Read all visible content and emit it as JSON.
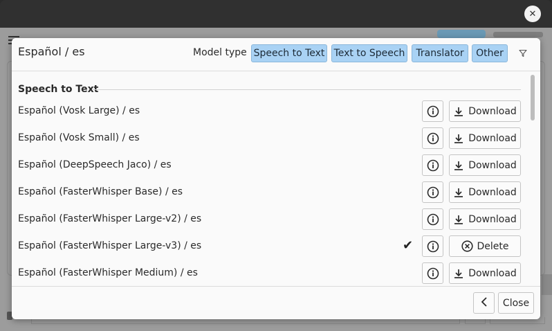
{
  "dialog": {
    "title": "Español / es",
    "model_type_label": "Model type",
    "chips": [
      "Speech to Text",
      "Text to Speech",
      "Translator",
      "Other"
    ],
    "filter_icon": "filter-icon",
    "section": "Speech to Text",
    "rows": [
      {
        "name": "Español (Vosk Large) / es",
        "action": "Download",
        "installed": false
      },
      {
        "name": "Español (Vosk Small) / es",
        "action": "Download",
        "installed": false
      },
      {
        "name": "Español (DeepSpeech Jaco) / es",
        "action": "Download",
        "installed": false
      },
      {
        "name": "Español (FasterWhisper Base) / es",
        "action": "Download",
        "installed": false
      },
      {
        "name": "Español (FasterWhisper Large-v2) / es",
        "action": "Download",
        "installed": false
      },
      {
        "name": "Español (FasterWhisper Large-v3) / es",
        "action": "Delete",
        "installed": true,
        "check": "✔"
      },
      {
        "name": "Español (FasterWhisper Medium) / es",
        "action": "Download",
        "installed": false
      }
    ],
    "footer": {
      "close_label": "Close"
    }
  },
  "colors": {
    "chip_bg": "#a9d2f4",
    "titlebar": "#303030",
    "dialog_bg": "#fafafa"
  }
}
